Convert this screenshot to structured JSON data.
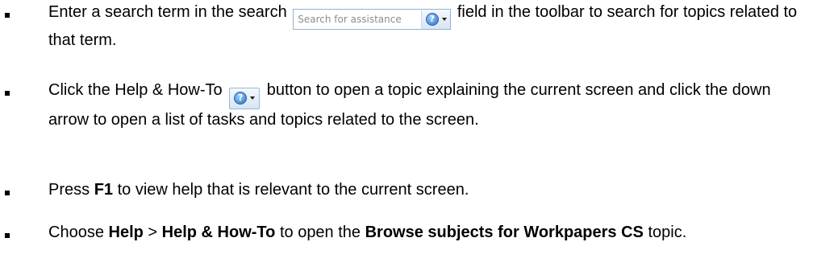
{
  "items": [
    {
      "pre": "Enter a search term in the search",
      "search_placeholder": "Search for assistance",
      "post": "field in the toolbar to search for topics related to that term."
    },
    {
      "pre": "Click the Help & How-To",
      "post": "button to open a topic explaining the current screen and click the down arrow to open a list of tasks and topics related to the screen."
    },
    {
      "pre": "Press",
      "key": "F1",
      "post": "to view help that is relevant to the current screen."
    },
    {
      "pre": "Choose",
      "menu": "Help",
      "sep": ">",
      "command": "Help & How-To",
      "mid": "to open the",
      "topic": "Browse subjects for Workpapers CS",
      "post": "topic."
    }
  ],
  "icons": {
    "help": "question-mark-icon",
    "dropdown": "chevron-down-icon"
  }
}
